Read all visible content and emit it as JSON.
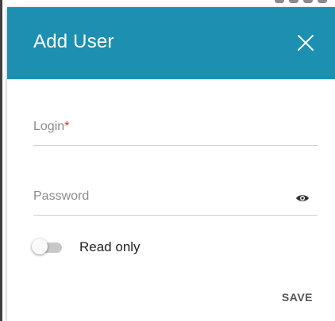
{
  "dialog": {
    "title": "Add User",
    "close_icon": "close-icon",
    "header_color": "#1d8fb1"
  },
  "fields": {
    "login": {
      "label": "Login",
      "required_marker": "*",
      "value": ""
    },
    "password": {
      "label": "Password",
      "value": "",
      "visibility_icon": "eye-icon"
    }
  },
  "read_only": {
    "label": "Read only",
    "checked": false
  },
  "actions": {
    "save_label": "SAVE"
  }
}
